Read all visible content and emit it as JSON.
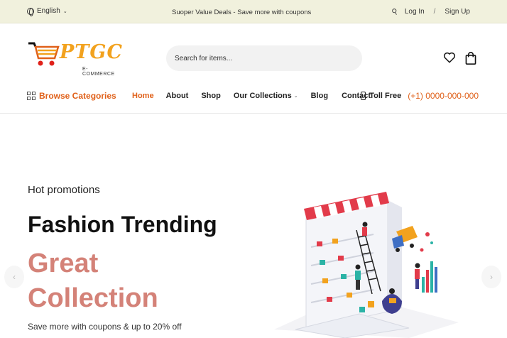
{
  "topbar": {
    "language": "English",
    "promo": "Suoper Value Deals - Save more with coupons",
    "login": "Log In",
    "separator": "/",
    "signup": "Sign Up"
  },
  "header": {
    "logo_brand": "PTGC",
    "logo_sub": "E-COMMERCE",
    "search_placeholder": "Search for items..."
  },
  "nav": {
    "browse": "Browse Categories",
    "items": [
      {
        "label": "Home"
      },
      {
        "label": "About"
      },
      {
        "label": "Shop"
      },
      {
        "label": "Our Collections"
      },
      {
        "label": "Blog"
      },
      {
        "label": "Contact"
      }
    ],
    "toll_label": "Toll Free",
    "toll_number": "(+1) 0000-000-000"
  },
  "hero": {
    "kicker": "Hot promotions",
    "headline": "Fashion Trending",
    "accent_line1": "Great",
    "accent_line2": "Collection",
    "subtext": "Save more with coupons & up to 20% off"
  },
  "colors": {
    "accent": "#e0611a",
    "hero_accent": "#d48278",
    "topbar_bg": "#f1f1dd",
    "logo": "#f2a21e"
  },
  "icons": [
    "globe-icon",
    "key-icon",
    "heart-icon",
    "shopping-bag-icon",
    "grid-icon",
    "phone-icon",
    "chevron-left-icon",
    "chevron-right-icon"
  ]
}
